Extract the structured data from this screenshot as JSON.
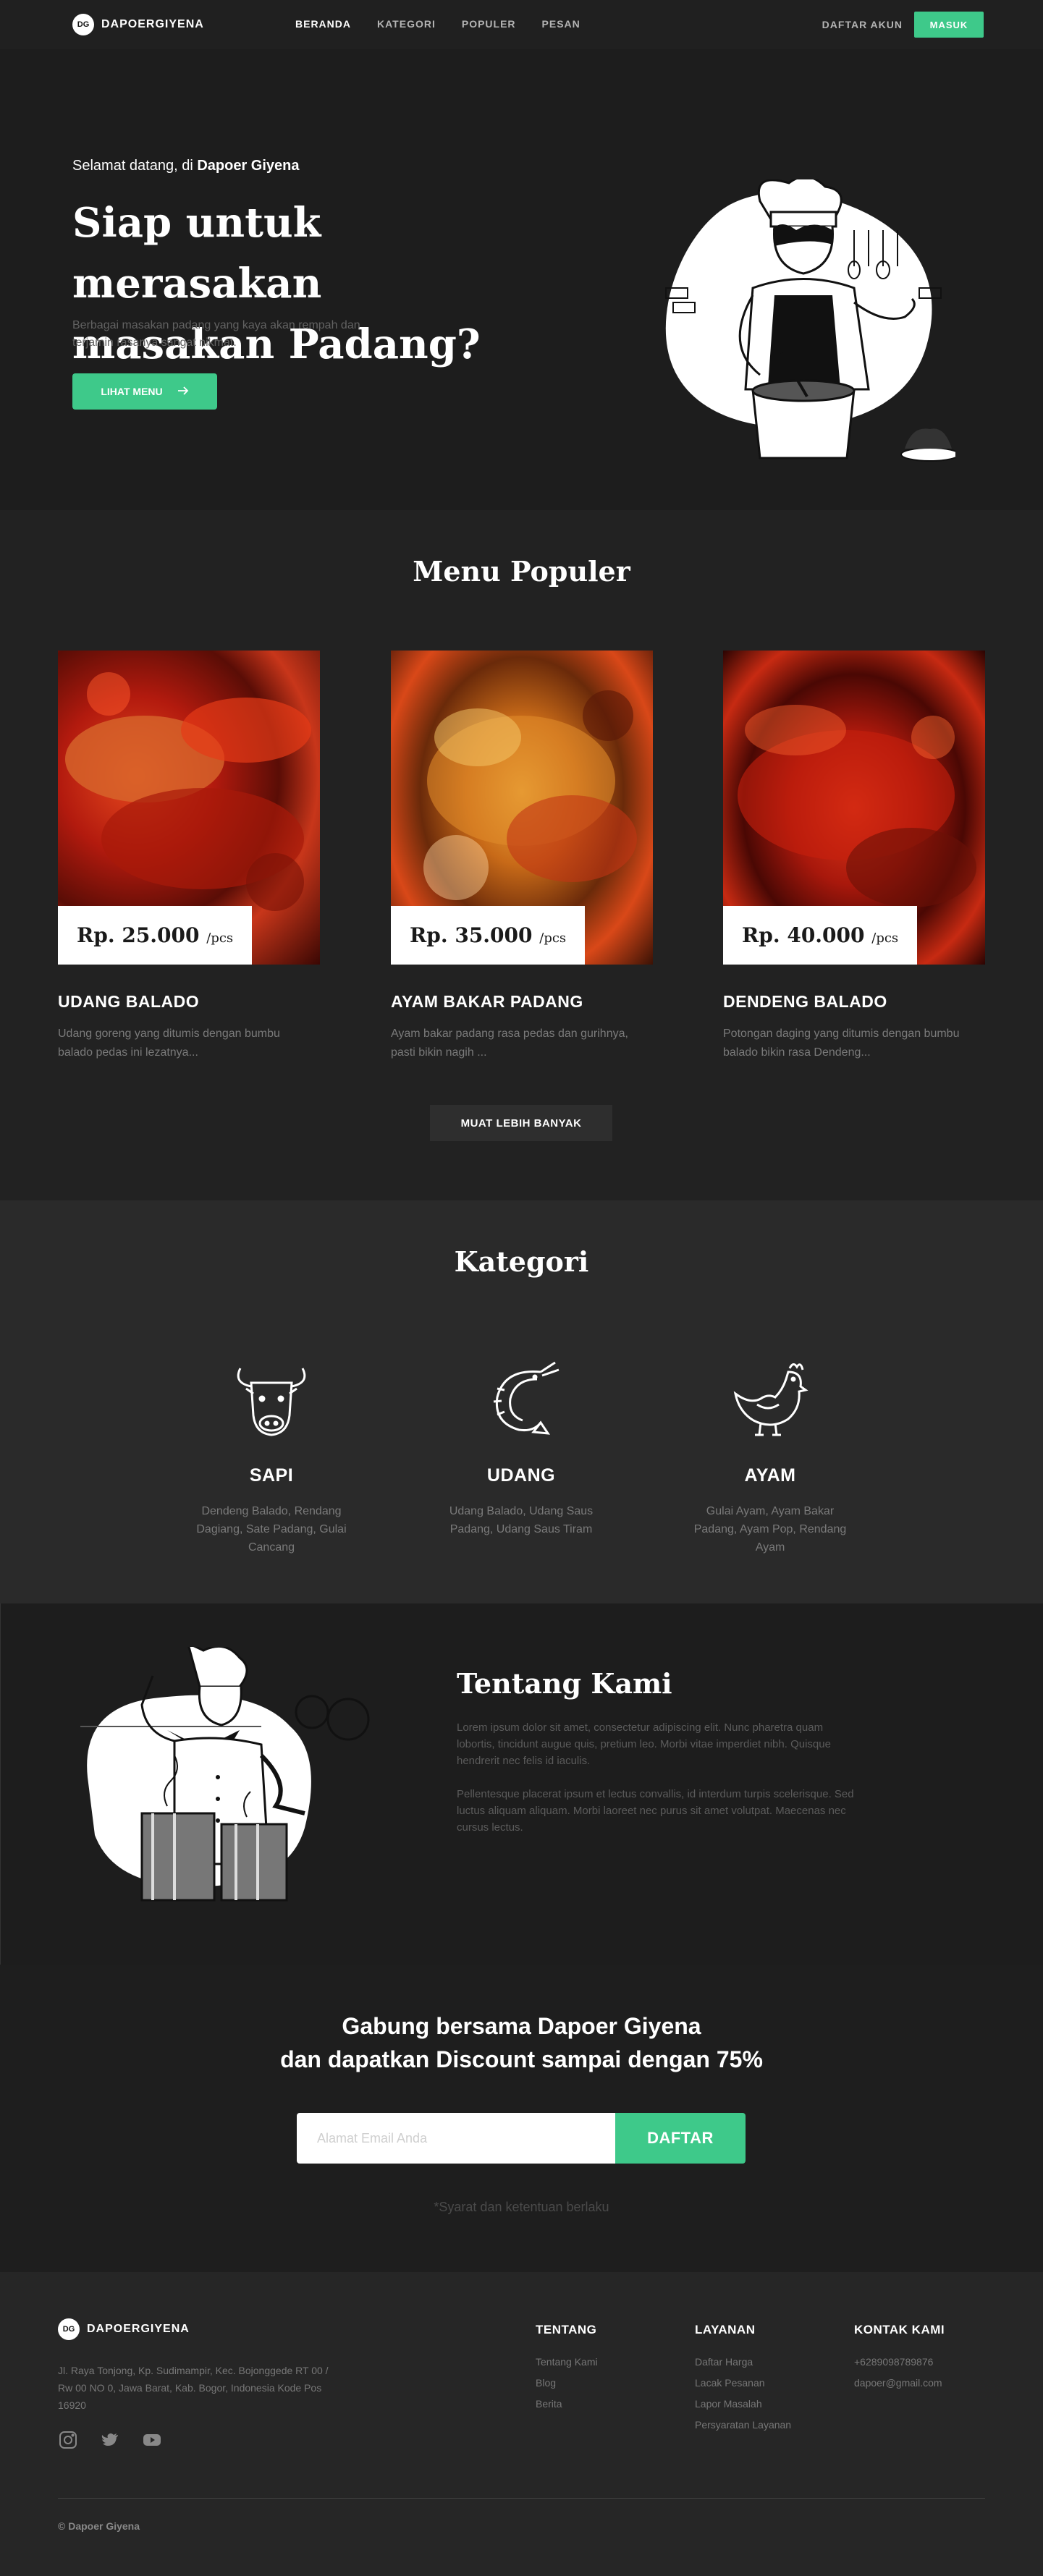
{
  "brand": {
    "mark": "DG",
    "name": "DAPOERGIYENA"
  },
  "nav": {
    "links": [
      "BERANDA",
      "KATEGORI",
      "POPULER",
      "PESAN"
    ],
    "register": "DAFTAR AKUN",
    "login": "MASUK"
  },
  "hero": {
    "greeting_prefix": "Selamat datang, di ",
    "greeting_brand": "Dapoer Giyena",
    "title": "Siap untuk merasakan masakan Padang?",
    "description": "Berbagai masakan padang yang kaya akan rempah dan terjamin rasanya sangat nikmat.",
    "cta": "LIHAT MENU"
  },
  "popular": {
    "title": "Menu Populer",
    "items": [
      {
        "price": "Rp. 25.000",
        "unit": "/pcs",
        "name": "UDANG BALADO",
        "desc": "Udang goreng yang ditumis dengan bumbu balado pedas ini lezatnya..."
      },
      {
        "price": "Rp. 35.000",
        "unit": "/pcs",
        "name": "AYAM BAKAR PADANG",
        "desc": "Ayam bakar padang rasa pedas dan gurihnya, pasti bikin nagih ..."
      },
      {
        "price": "Rp. 40.000",
        "unit": "/pcs",
        "name": "DENDENG BALADO",
        "desc": "Potongan daging yang ditumis dengan bumbu balado bikin rasa Dendeng..."
      }
    ],
    "load_more": "MUAT LEBIH BANYAK"
  },
  "kategori": {
    "title": "Kategori",
    "items": [
      {
        "icon": "cow-icon",
        "name": "SAPI",
        "desc": "Dendeng Balado, Rendang Dagiang, Sate Padang, Gulai Cancang"
      },
      {
        "icon": "shrimp-icon",
        "name": "UDANG",
        "desc": "Udang Balado,  Udang Saus Padang, Udang Saus Tiram"
      },
      {
        "icon": "chicken-icon",
        "name": "AYAM",
        "desc": "Gulai Ayam,  Ayam Bakar Padang,  Ayam Pop, Rendang Ayam"
      }
    ]
  },
  "tentang": {
    "title": "Tentang Kami",
    "p1": "Lorem ipsum dolor sit amet, consectetur adipiscing elit. Nunc pharetra quam lobortis, tincidunt augue quis, pretium leo. Morbi vitae imperdiet nibh. Quisque hendrerit nec felis id iaculis.",
    "p2": "Pellentesque placerat ipsum et lectus convallis, id interdum turpis scelerisque. Sed luctus aliquam aliquam. Morbi laoreet nec purus sit amet volutpat. Maecenas nec cursus lectus."
  },
  "newsletter": {
    "title_line1": "Gabung bersama Dapoer Giyena",
    "title_line2": "dan dapatkan Discount sampai dengan 75%",
    "placeholder": "Alamat Email Anda",
    "button": "DAFTAR",
    "note": "*Syarat dan ketentuan berlaku"
  },
  "footer": {
    "address": "Jl. Raya Tonjong, Kp. Sudimampir, Kec. Bojonggede RT 00 / Rw 00 NO 0, Jawa Barat, Kab. Bogor, Indonesia Kode Pos 16920",
    "social": [
      "instagram-icon",
      "twitter-icon",
      "youtube-icon"
    ],
    "columns": [
      {
        "title": "TENTANG",
        "items": [
          "Tentang Kami",
          "Blog",
          "Berita"
        ]
      },
      {
        "title": "LAYANAN",
        "items": [
          "Daftar Harga",
          "Lacak Pesanan",
          "Lapor Masalah",
          "Persyaratan Layanan"
        ]
      },
      {
        "title": "KONTAK KAMI",
        "items": [
          "+6289098789876",
          "dapoer@gmail.com"
        ]
      }
    ],
    "copyright": "© Dapoer Giyena"
  },
  "colors": {
    "accent": "#3ec98a",
    "background": "#1d1d1d"
  }
}
